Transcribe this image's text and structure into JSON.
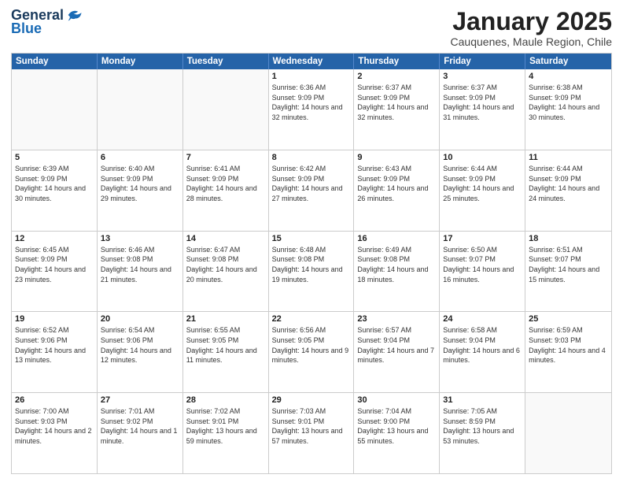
{
  "logo": {
    "general": "General",
    "blue": "Blue"
  },
  "header": {
    "month": "January 2025",
    "location": "Cauquenes, Maule Region, Chile"
  },
  "dayHeaders": [
    "Sunday",
    "Monday",
    "Tuesday",
    "Wednesday",
    "Thursday",
    "Friday",
    "Saturday"
  ],
  "rows": [
    [
      {
        "num": "",
        "empty": true
      },
      {
        "num": "",
        "empty": true
      },
      {
        "num": "",
        "empty": true
      },
      {
        "num": "1",
        "sunrise": "6:36 AM",
        "sunset": "9:09 PM",
        "daylight": "14 hours and 32 minutes."
      },
      {
        "num": "2",
        "sunrise": "6:37 AM",
        "sunset": "9:09 PM",
        "daylight": "14 hours and 32 minutes."
      },
      {
        "num": "3",
        "sunrise": "6:37 AM",
        "sunset": "9:09 PM",
        "daylight": "14 hours and 31 minutes."
      },
      {
        "num": "4",
        "sunrise": "6:38 AM",
        "sunset": "9:09 PM",
        "daylight": "14 hours and 30 minutes."
      }
    ],
    [
      {
        "num": "5",
        "sunrise": "6:39 AM",
        "sunset": "9:09 PM",
        "daylight": "14 hours and 30 minutes."
      },
      {
        "num": "6",
        "sunrise": "6:40 AM",
        "sunset": "9:09 PM",
        "daylight": "14 hours and 29 minutes."
      },
      {
        "num": "7",
        "sunrise": "6:41 AM",
        "sunset": "9:09 PM",
        "daylight": "14 hours and 28 minutes."
      },
      {
        "num": "8",
        "sunrise": "6:42 AM",
        "sunset": "9:09 PM",
        "daylight": "14 hours and 27 minutes."
      },
      {
        "num": "9",
        "sunrise": "6:43 AM",
        "sunset": "9:09 PM",
        "daylight": "14 hours and 26 minutes."
      },
      {
        "num": "10",
        "sunrise": "6:44 AM",
        "sunset": "9:09 PM",
        "daylight": "14 hours and 25 minutes."
      },
      {
        "num": "11",
        "sunrise": "6:44 AM",
        "sunset": "9:09 PM",
        "daylight": "14 hours and 24 minutes."
      }
    ],
    [
      {
        "num": "12",
        "sunrise": "6:45 AM",
        "sunset": "9:09 PM",
        "daylight": "14 hours and 23 minutes."
      },
      {
        "num": "13",
        "sunrise": "6:46 AM",
        "sunset": "9:08 PM",
        "daylight": "14 hours and 21 minutes."
      },
      {
        "num": "14",
        "sunrise": "6:47 AM",
        "sunset": "9:08 PM",
        "daylight": "14 hours and 20 minutes."
      },
      {
        "num": "15",
        "sunrise": "6:48 AM",
        "sunset": "9:08 PM",
        "daylight": "14 hours and 19 minutes."
      },
      {
        "num": "16",
        "sunrise": "6:49 AM",
        "sunset": "9:08 PM",
        "daylight": "14 hours and 18 minutes."
      },
      {
        "num": "17",
        "sunrise": "6:50 AM",
        "sunset": "9:07 PM",
        "daylight": "14 hours and 16 minutes."
      },
      {
        "num": "18",
        "sunrise": "6:51 AM",
        "sunset": "9:07 PM",
        "daylight": "14 hours and 15 minutes."
      }
    ],
    [
      {
        "num": "19",
        "sunrise": "6:52 AM",
        "sunset": "9:06 PM",
        "daylight": "14 hours and 13 minutes."
      },
      {
        "num": "20",
        "sunrise": "6:54 AM",
        "sunset": "9:06 PM",
        "daylight": "14 hours and 12 minutes."
      },
      {
        "num": "21",
        "sunrise": "6:55 AM",
        "sunset": "9:05 PM",
        "daylight": "14 hours and 11 minutes."
      },
      {
        "num": "22",
        "sunrise": "6:56 AM",
        "sunset": "9:05 PM",
        "daylight": "14 hours and 9 minutes."
      },
      {
        "num": "23",
        "sunrise": "6:57 AM",
        "sunset": "9:04 PM",
        "daylight": "14 hours and 7 minutes."
      },
      {
        "num": "24",
        "sunrise": "6:58 AM",
        "sunset": "9:04 PM",
        "daylight": "14 hours and 6 minutes."
      },
      {
        "num": "25",
        "sunrise": "6:59 AM",
        "sunset": "9:03 PM",
        "daylight": "14 hours and 4 minutes."
      }
    ],
    [
      {
        "num": "26",
        "sunrise": "7:00 AM",
        "sunset": "9:03 PM",
        "daylight": "14 hours and 2 minutes."
      },
      {
        "num": "27",
        "sunrise": "7:01 AM",
        "sunset": "9:02 PM",
        "daylight": "14 hours and 1 minute."
      },
      {
        "num": "28",
        "sunrise": "7:02 AM",
        "sunset": "9:01 PM",
        "daylight": "13 hours and 59 minutes."
      },
      {
        "num": "29",
        "sunrise": "7:03 AM",
        "sunset": "9:01 PM",
        "daylight": "13 hours and 57 minutes."
      },
      {
        "num": "30",
        "sunrise": "7:04 AM",
        "sunset": "9:00 PM",
        "daylight": "13 hours and 55 minutes."
      },
      {
        "num": "31",
        "sunrise": "7:05 AM",
        "sunset": "8:59 PM",
        "daylight": "13 hours and 53 minutes."
      },
      {
        "num": "",
        "empty": true
      }
    ]
  ],
  "labels": {
    "sunrise": "Sunrise:",
    "sunset": "Sunset:",
    "daylight": "Daylight:"
  }
}
